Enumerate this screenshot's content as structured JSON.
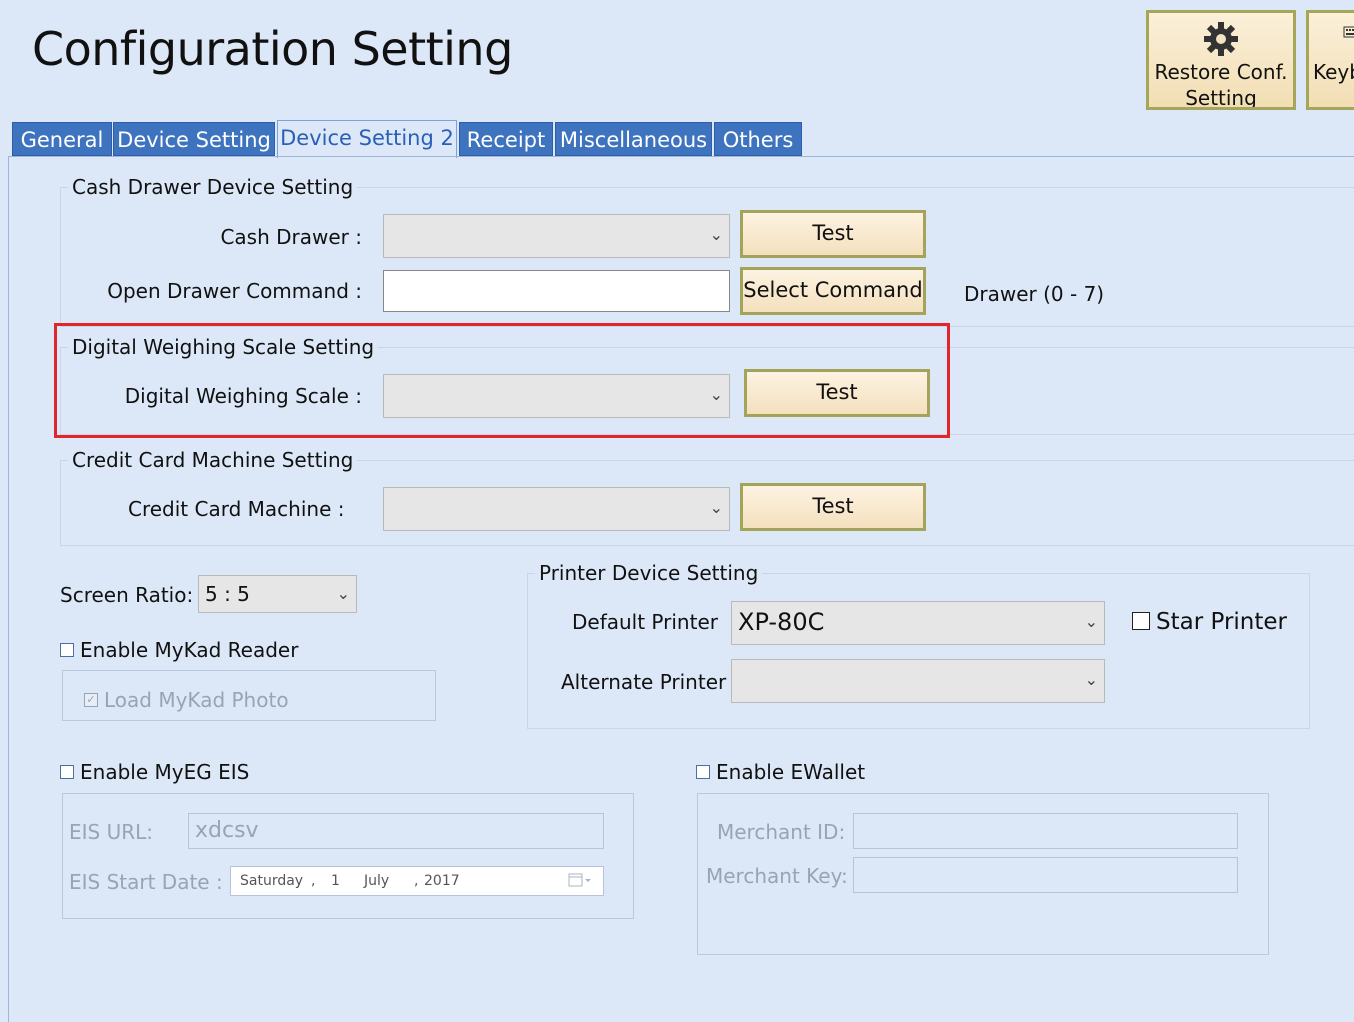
{
  "header": {
    "title": "Configuration Setting",
    "restore_button": [
      "Restore Conf.",
      "Setting"
    ],
    "keyboard_button_partial": "Keyb"
  },
  "tabs": [
    "General",
    "Device Setting",
    "Device Setting 2",
    "Receipt",
    "Miscellaneous",
    "Others"
  ],
  "active_tab": "Device Setting 2",
  "cash_drawer": {
    "legend": "Cash Drawer Device Setting",
    "drawer_label": "Cash Drawer :",
    "drawer_value": "",
    "test_button": "Test",
    "command_label": "Open Drawer Command :",
    "command_value": "",
    "select_command_button": "Select Command",
    "drawer_range": "Drawer (0 - 7)"
  },
  "weighing_scale": {
    "legend": "Digital Weighing Scale Setting",
    "scale_label": "Digital Weighing Scale :",
    "scale_value": "",
    "test_button": "Test"
  },
  "credit_card": {
    "legend": "Credit Card Machine Setting",
    "machine_label": "Credit Card Machine :",
    "machine_value": "",
    "test_button": "Test"
  },
  "screen_ratio": {
    "label": "Screen Ratio:",
    "value": "5 : 5"
  },
  "mykad": {
    "enable_label": "Enable MyKad Reader",
    "load_photo_label": "Load MyKad Photo"
  },
  "printer": {
    "legend": "Printer Device Setting",
    "default_label": "Default Printer",
    "default_value": "XP-80C",
    "star_printer_label": "Star Printer",
    "alternate_label": "Alternate Printer",
    "alternate_value": ""
  },
  "myeg": {
    "enable_label": "Enable MyEG EIS",
    "url_label": "EIS URL:",
    "url_value": "xdcsv",
    "start_date_label": "EIS Start Date :",
    "date_day_name": "Saturday",
    "date_day": "1",
    "date_month": "July",
    "date_year": "2017"
  },
  "ewallet": {
    "enable_label": "Enable EWallet",
    "merchant_id_label": "Merchant ID:",
    "merchant_id_value": "",
    "merchant_key_label": "Merchant Key:",
    "merchant_key_value": ""
  },
  "colors": {
    "background": "#dce8f7",
    "tab": "#3e73bf",
    "highlight": "#e0262b",
    "button": "#f4e0be"
  }
}
